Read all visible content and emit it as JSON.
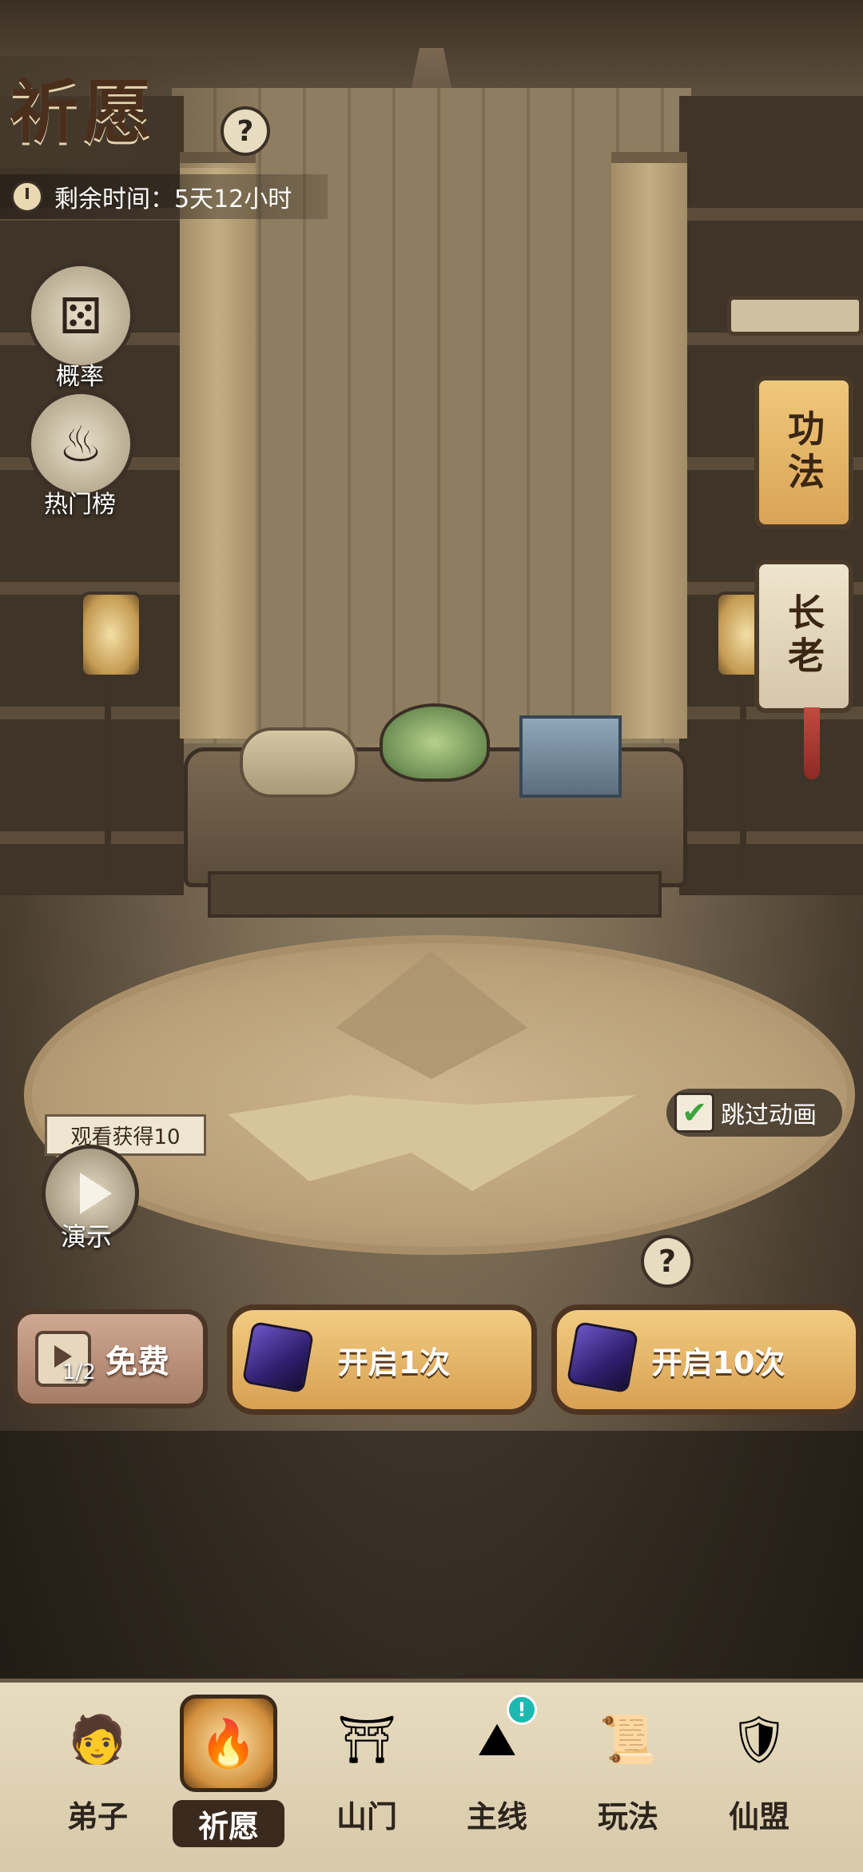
{
  "header": {
    "title": "祈愿",
    "help_icon": "?",
    "timer_label": "剩余时间：5天12小时"
  },
  "left_menu": [
    {
      "label": "概率",
      "icon": "dice-icon"
    },
    {
      "label": "热门榜",
      "icon": "rank-icon"
    }
  ],
  "right_tabs": [
    {
      "label": "功法",
      "active": true
    },
    {
      "label": "长老",
      "active": false
    }
  ],
  "skip_animation": {
    "label": "跳过动画",
    "checked": true
  },
  "demo": {
    "tag": "观看获得10",
    "label": "演示"
  },
  "actions": {
    "help_icon": "?",
    "free": {
      "count": "1/2",
      "label": "免费"
    },
    "draw_once": "开启1次",
    "draw_ten": "开启10次"
  },
  "bottom_nav": [
    {
      "label": "弟子",
      "icon": "disciple-icon",
      "active": false
    },
    {
      "label": "祈愿",
      "icon": "wish-icon",
      "active": true
    },
    {
      "label": "山门",
      "icon": "gate-icon",
      "active": false
    },
    {
      "label": "主线",
      "icon": "main-quest-icon",
      "active": false,
      "badge": "!"
    },
    {
      "label": "玩法",
      "icon": "gameplay-icon",
      "active": false
    },
    {
      "label": "仙盟",
      "icon": "guild-icon",
      "active": false
    }
  ],
  "colors": {
    "accent_gold": "#d8a052",
    "crystal_purple": "#6d55c7",
    "check_green": "#3ba53b"
  }
}
